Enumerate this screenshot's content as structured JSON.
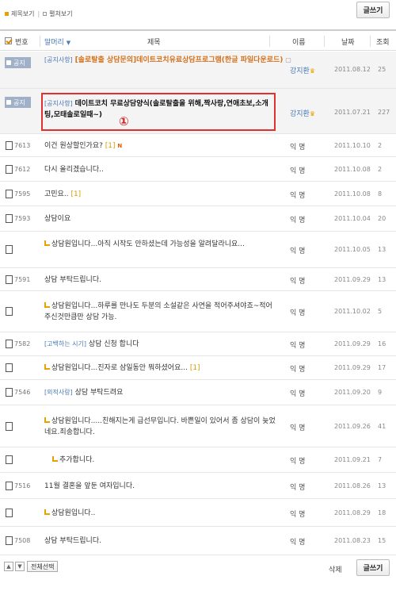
{
  "view_options": {
    "title_view": "제목보기",
    "expand_view": "펼쳐보기"
  },
  "buttons": {
    "write": "글쓰기",
    "select_all": "전체선택",
    "delete": "삭제",
    "up": "▲",
    "down": "▼"
  },
  "columns": {
    "number": "번호",
    "category": "말머리",
    "category_arrow": "▼",
    "subject": "제목",
    "author": "이름",
    "date": "날짜",
    "hits": "조회"
  },
  "annotation": {
    "marker": "①"
  },
  "notices": [
    {
      "badge": "공지",
      "category": "[공지사항]",
      "title": "[솔로탈출 상담문의]데이트코치유료상담프로그램(한글 파일다운로드)",
      "attach": "▢",
      "author": "강지환",
      "author_mark": "♛",
      "date": "2011.08.12",
      "hits": "25"
    },
    {
      "badge": "공지",
      "category": "[공지사항]",
      "title": "데이트코치 무료상담양식(솔로탈출을 위해,짝사랑,연애초보,소개팅,모태솔로일때~)",
      "author": "강지환",
      "author_mark": "♛",
      "date": "2011.07.21",
      "hits": "227"
    }
  ],
  "posts": [
    {
      "num": "7613",
      "category": "",
      "subject": "이건 원상할인가요?",
      "count": "[1]",
      "new": "N",
      "reply": false,
      "author": "익 명",
      "date": "2011.10.10",
      "hits": "2"
    },
    {
      "num": "7612",
      "category": "",
      "subject": "다시 올리겠습니다..",
      "count": "",
      "new": "",
      "reply": false,
      "author": "익 명",
      "date": "2011.10.08",
      "hits": "2"
    },
    {
      "num": "7595",
      "category": "",
      "subject": "고민요..",
      "count": "[1]",
      "new": "",
      "reply": false,
      "author": "익 명",
      "date": "2011.10.08",
      "hits": "8"
    },
    {
      "num": "7593",
      "category": "",
      "subject": "상담이요",
      "count": "",
      "new": "",
      "reply": false,
      "author": "익 명",
      "date": "2011.10.04",
      "hits": "20"
    },
    {
      "num": "",
      "category": "",
      "subject": "상담원입니다...아직 시작도 안하셨는데 가능성을 알려달라니요...",
      "count": "",
      "new": "",
      "reply": true,
      "author": "익 명",
      "date": "2011.10.05",
      "hits": "13"
    },
    {
      "num": "7591",
      "category": "",
      "subject": "상담 부탁드립니다.",
      "count": "",
      "new": "",
      "reply": false,
      "author": "익 명",
      "date": "2011.09.29",
      "hits": "13"
    },
    {
      "num": "",
      "category": "",
      "subject": "상담원입니다...하루를 만나도 두분의 소설같은 사연을 적어주셔야죠~적어주신것만큼만 상담 가능.",
      "count": "",
      "new": "",
      "reply": true,
      "author": "익 명",
      "date": "2011.10.02",
      "hits": "5"
    },
    {
      "num": "7582",
      "category": "[고백하는 시기]",
      "subject": "상담 신청 합니다",
      "count": "",
      "new": "",
      "reply": false,
      "author": "익 명",
      "date": "2011.09.29",
      "hits": "16"
    },
    {
      "num": "",
      "category": "",
      "subject": "상담원입니다...진자로 삼일동안 뭐하셨어요...",
      "count": "[1]",
      "new": "",
      "reply": true,
      "author": "익 명",
      "date": "2011.09.29",
      "hits": "17"
    },
    {
      "num": "7546",
      "category": "[외적사랑]",
      "subject": "상담 부탁드려요",
      "count": "",
      "new": "",
      "reply": false,
      "author": "익 명",
      "date": "2011.09.20",
      "hits": "9"
    },
    {
      "num": "",
      "category": "",
      "subject": "상담원입니다.....친해지는게 급선무입니다. 바쁜일이 있어서 좀 상담이 늦었네요.죄송합니다.",
      "count": "",
      "new": "",
      "reply": true,
      "author": "익 명",
      "date": "2011.09.26",
      "hits": "41"
    },
    {
      "num": "",
      "category": "",
      "subject": "추가합니다.",
      "count": "",
      "new": "",
      "reply": true,
      "indent": 2,
      "author": "익 명",
      "date": "2011.09.21",
      "hits": "7"
    },
    {
      "num": "7516",
      "category": "",
      "subject": "11월 결혼을 앞둔 여자입니다.",
      "count": "",
      "new": "",
      "reply": false,
      "author": "익 명",
      "date": "2011.08.26",
      "hits": "13"
    },
    {
      "num": "",
      "category": "",
      "subject": "상담원입니다..",
      "count": "",
      "new": "",
      "reply": true,
      "author": "익 명",
      "date": "2011.08.29",
      "hits": "18"
    },
    {
      "num": "7508",
      "category": "",
      "subject": "상담 부탁드립니다.",
      "count": "",
      "new": "",
      "reply": false,
      "author": "익 명",
      "date": "2011.08.23",
      "hits": "15"
    }
  ]
}
